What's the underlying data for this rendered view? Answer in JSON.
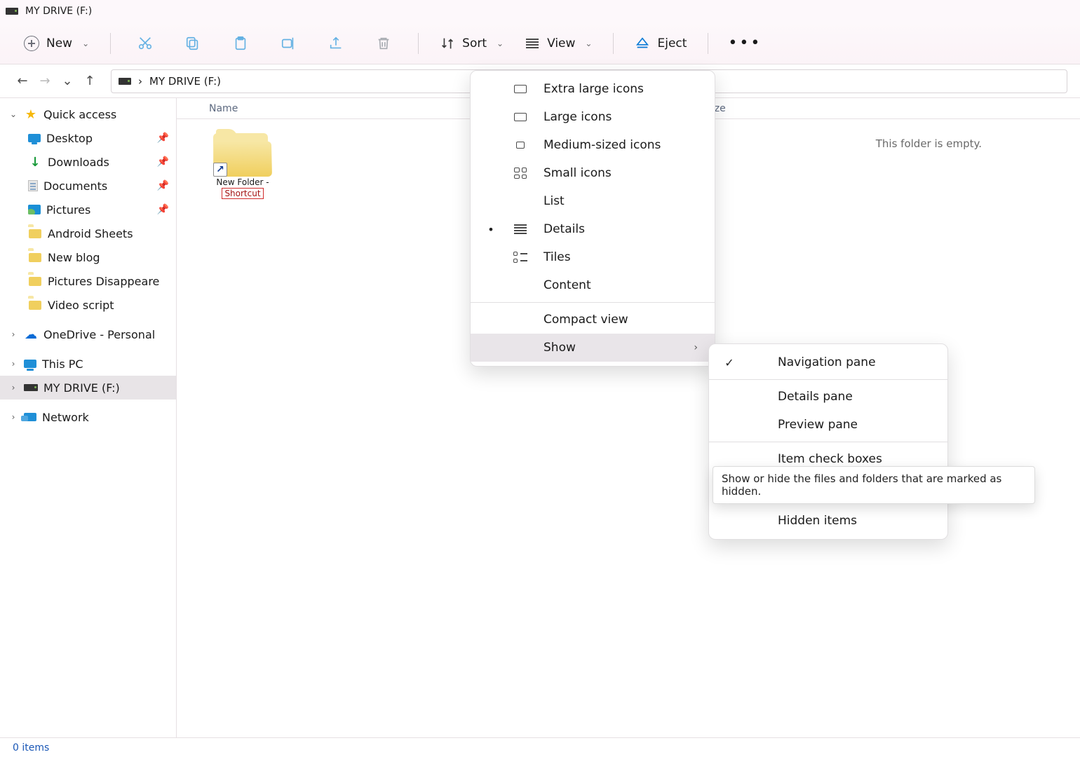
{
  "title": "MY DRIVE (F:)",
  "toolbar": {
    "new_label": "New",
    "sort_label": "Sort",
    "view_label": "View",
    "eject_label": "Eject"
  },
  "breadcrumb": {
    "sep": "›",
    "label": "MY DRIVE (F:)"
  },
  "sidebar": {
    "quick_access": "Quick access",
    "desktop": "Desktop",
    "downloads": "Downloads",
    "documents": "Documents",
    "pictures": "Pictures",
    "android_sheets": "Android Sheets",
    "new_blog": "New blog",
    "pictures_disappeared": "Pictures Disappeare",
    "video_script": "Video script",
    "onedrive": "OneDrive - Personal",
    "this_pc": "This PC",
    "my_drive": "MY DRIVE (F:)",
    "network": "Network"
  },
  "columns": {
    "name": "Name",
    "size": "Size"
  },
  "content": {
    "item_line1": "New Folder -",
    "item_line2": "Shortcut",
    "empty": "This folder is empty."
  },
  "status": {
    "items": "0 items"
  },
  "view_menu": {
    "xl": "Extra large icons",
    "lg": "Large icons",
    "md": "Medium-sized icons",
    "sm": "Small icons",
    "list": "List",
    "details": "Details",
    "tiles": "Tiles",
    "content": "Content",
    "compact": "Compact view",
    "show": "Show"
  },
  "show_menu": {
    "nav": "Navigation pane",
    "details": "Details pane",
    "preview": "Preview pane",
    "checkboxes": "Item check boxes",
    "hidden": "Hidden items"
  },
  "tooltip": {
    "text": "Show or hide the files and folders that are marked as hidden."
  }
}
